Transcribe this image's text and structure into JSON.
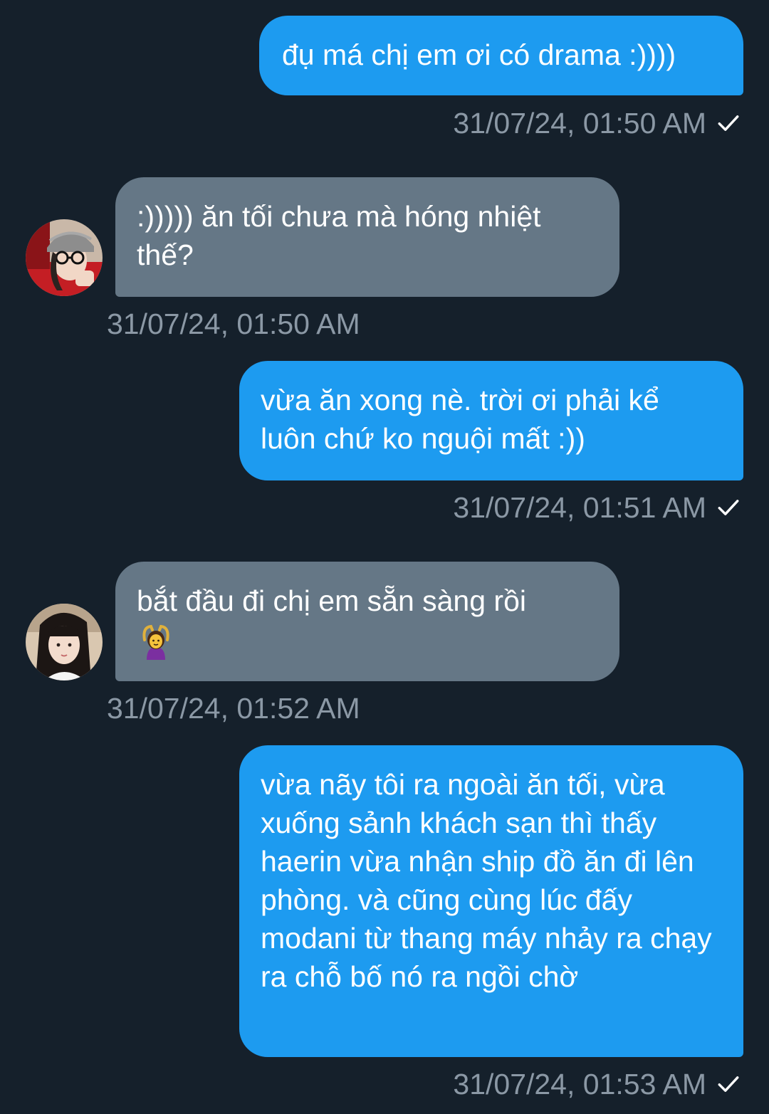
{
  "colors": {
    "background": "#15202b",
    "sent_bubble": "#1d9bf0",
    "received_bubble": "#657786",
    "timestamp": "#8b98a5"
  },
  "messages": [
    {
      "direction": "sent",
      "text": "đụ má chị em ơi có drama :))))",
      "timestamp": "31/07/24, 01:50 AM",
      "status_icon": "check-icon"
    },
    {
      "direction": "received",
      "text": ":))))) ăn tối chưa mà hóng nhiệt thế?",
      "timestamp": "31/07/24, 01:50 AM",
      "avatar_icon": "avatar"
    },
    {
      "direction": "sent",
      "text": "vừa ăn xong nè. trời ơi phải kể luôn chứ ko nguội mất :))",
      "timestamp": "31/07/24, 01:51 AM",
      "status_icon": "check-icon"
    },
    {
      "direction": "received",
      "text": "bắt đầu đi chị em sẵn sàng rồi",
      "emoji": "woman-gesturing-ok-icon",
      "timestamp": "31/07/24, 01:52 AM",
      "avatar_icon": "avatar"
    },
    {
      "direction": "sent",
      "text": "vừa nãy tôi ra ngoài ăn tối, vừa xuống sảnh khách sạn thì thấy haerin vừa nhận ship đồ ăn đi lên phòng. và cũng cùng lúc đấy modani từ thang máy nhảy ra chạy ra chỗ bố nó ra ngồi chờ",
      "timestamp": "31/07/24, 01:53 AM",
      "status_icon": "check-icon"
    }
  ]
}
